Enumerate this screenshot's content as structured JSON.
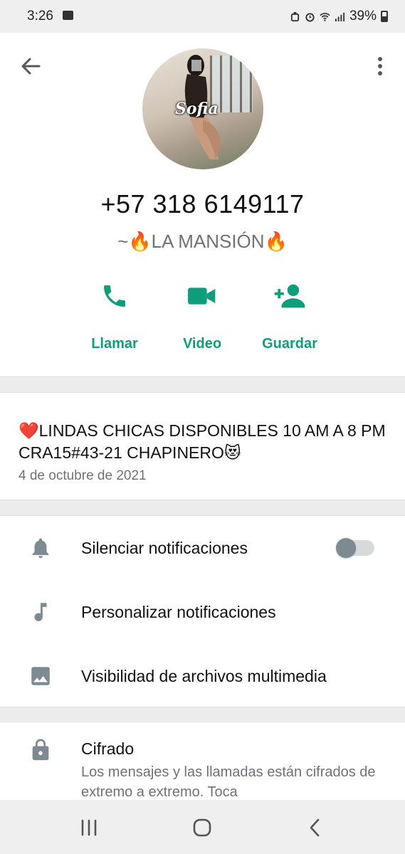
{
  "status_bar": {
    "time": "3:26",
    "battery": "39%",
    "icons": [
      "gallery-icon",
      "alarm-shield-icon",
      "alarm-icon",
      "wifi-icon",
      "signal-icon",
      "battery-icon"
    ]
  },
  "header": {
    "back_icon": "arrow-back-icon",
    "menu_icon": "more-vert-icon",
    "avatar_signature": "Sofia",
    "phone_number": "+57 318 6149117",
    "status_name": "~🔥LA MANSIÓN🔥"
  },
  "actions": {
    "call_label": "Llamar",
    "video_label": "Video",
    "save_label": "Guardar"
  },
  "about": {
    "text": "❤️LINDAS CHICAS DISPONIBLES 10 AM A 8 PM CRA15#43-21 CHAPINERO😻",
    "date": "4 de octubre de 2021"
  },
  "settings": {
    "mute_label": "Silenciar notificaciones",
    "mute_enabled": false,
    "custom_notif_label": "Personalizar notificaciones",
    "media_visibility_label": "Visibilidad de archivos multimedia"
  },
  "encryption": {
    "title": "Cifrado",
    "description": "Los mensajes y las llamadas están cifrados de extremo a extremo. Toca"
  },
  "colors": {
    "accent": "#0f9e7a",
    "secondary_text": "#6f7275",
    "icon_gray": "#7d8a92"
  }
}
